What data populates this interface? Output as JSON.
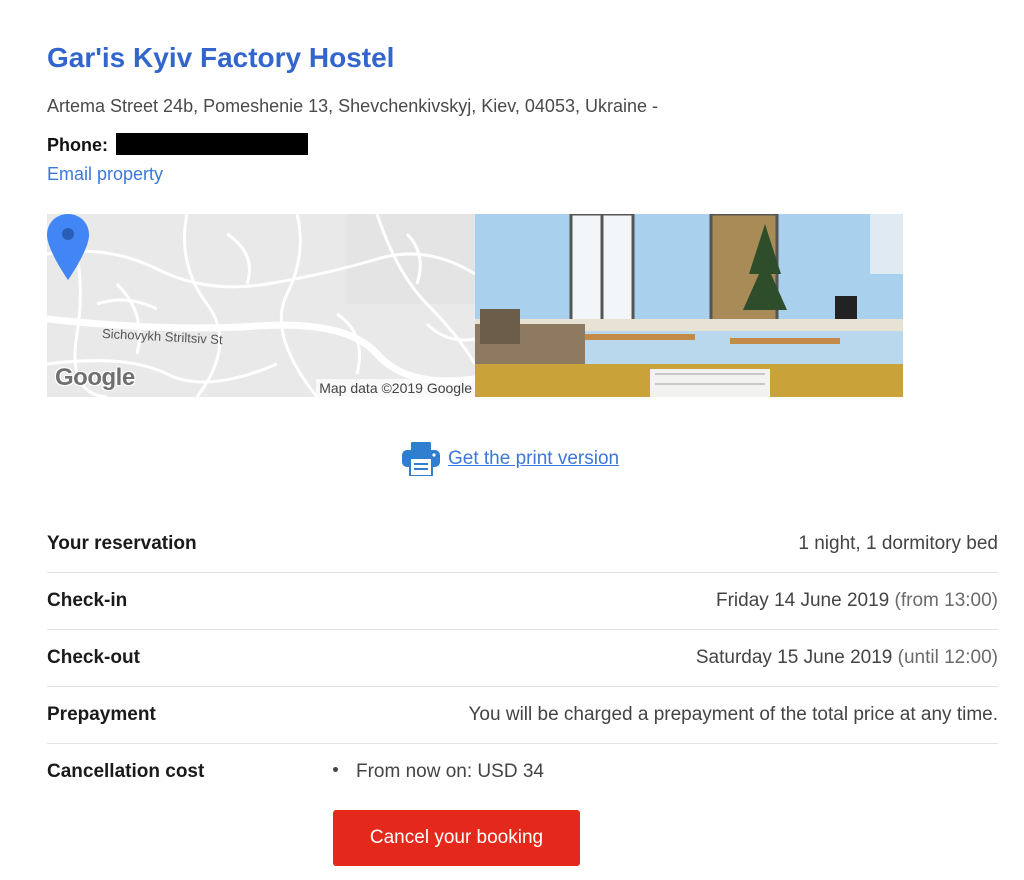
{
  "property": {
    "name": "Gar'is Kyiv Factory Hostel",
    "address": "Artema Street 24b, Pomeshenie 13, Shevchenkivskyj, Kiev, 04053, Ukraine -",
    "phone_label": "Phone:",
    "email_link": "Email property"
  },
  "map": {
    "street_label": "Sichovykh Striltsiv St",
    "logo_text": "Google",
    "attribution": "Map data ©2019 Google"
  },
  "print": {
    "link_label": "Get the print version",
    "icon": "printer-icon"
  },
  "reservation": {
    "rows": [
      {
        "label": "Your reservation",
        "value": "1 night, 1 dormitory bed",
        "note": ""
      },
      {
        "label": "Check-in",
        "value": "Friday 14 June 2019",
        "note": "(from 13:00)"
      },
      {
        "label": "Check-out",
        "value": "Saturday 15 June 2019",
        "note": "(until 12:00)"
      },
      {
        "label": "Prepayment",
        "value": "You will be charged a prepayment of the total price at any time.",
        "note": ""
      }
    ],
    "cancellation": {
      "label": "Cancellation cost",
      "items": [
        "From now on: USD 34"
      ]
    }
  },
  "actions": {
    "cancel_label": "Cancel your booking"
  },
  "colors": {
    "title": "#3366cc",
    "link": "#3c78d8",
    "cancel_button": "#e5281c",
    "map_pin": "#4285f4"
  }
}
